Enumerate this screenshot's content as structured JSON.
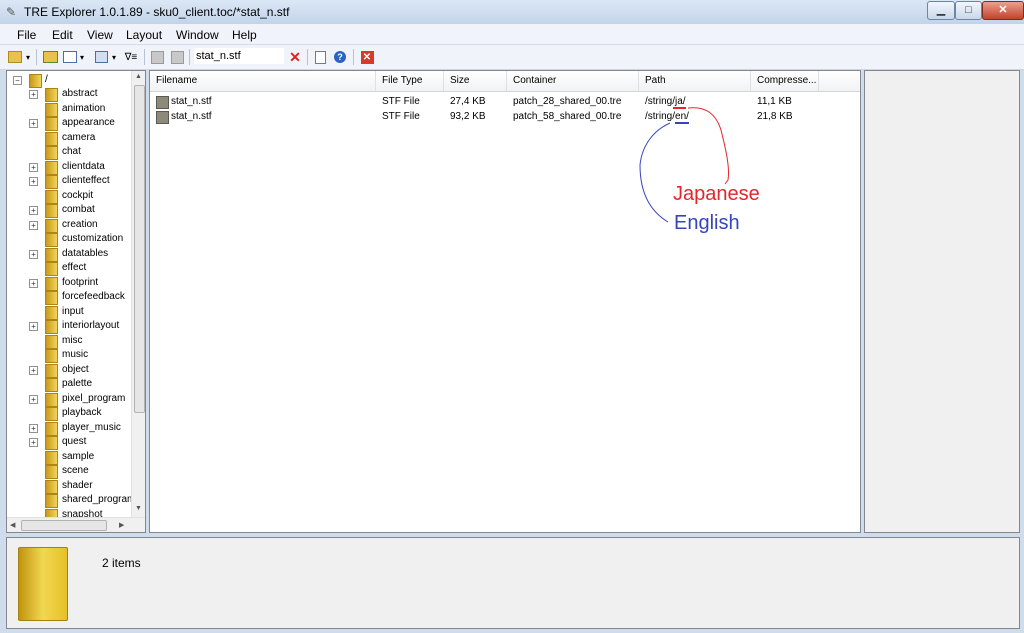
{
  "window": {
    "title": "TRE Explorer 1.0.1.89 - sku0_client.toc/*stat_n.stf",
    "minimize": "▁",
    "maximize": "□",
    "close": "✕"
  },
  "menu": [
    "File",
    "Edit",
    "View",
    "Layout",
    "Window",
    "Help"
  ],
  "toolbar": {
    "search_value": "stat_n.stf"
  },
  "tree": {
    "root": "/",
    "items": [
      {
        "label": "abstract",
        "expandable": true
      },
      {
        "label": "animation",
        "expandable": false
      },
      {
        "label": "appearance",
        "expandable": true
      },
      {
        "label": "camera",
        "expandable": false
      },
      {
        "label": "chat",
        "expandable": false
      },
      {
        "label": "clientdata",
        "expandable": true
      },
      {
        "label": "clienteffect",
        "expandable": true
      },
      {
        "label": "cockpit",
        "expandable": false
      },
      {
        "label": "combat",
        "expandable": true
      },
      {
        "label": "creation",
        "expandable": true
      },
      {
        "label": "customization",
        "expandable": false
      },
      {
        "label": "datatables",
        "expandable": true
      },
      {
        "label": "effect",
        "expandable": false
      },
      {
        "label": "footprint",
        "expandable": true
      },
      {
        "label": "forcefeedback",
        "expandable": false
      },
      {
        "label": "input",
        "expandable": false
      },
      {
        "label": "interiorlayout",
        "expandable": true
      },
      {
        "label": "misc",
        "expandable": false
      },
      {
        "label": "music",
        "expandable": false
      },
      {
        "label": "object",
        "expandable": true
      },
      {
        "label": "palette",
        "expandable": false
      },
      {
        "label": "pixel_program",
        "expandable": true
      },
      {
        "label": "playback",
        "expandable": false
      },
      {
        "label": "player_music",
        "expandable": true
      },
      {
        "label": "quest",
        "expandable": true
      },
      {
        "label": "sample",
        "expandable": false
      },
      {
        "label": "scene",
        "expandable": false
      },
      {
        "label": "shader",
        "expandable": false
      },
      {
        "label": "shared_program",
        "expandable": false
      },
      {
        "label": "snapshot",
        "expandable": false
      }
    ]
  },
  "list": {
    "columns": [
      "Filename",
      "File Type",
      "Size",
      "Container",
      "Path",
      "Compresse..."
    ],
    "rows": [
      {
        "filename": "stat_n.stf",
        "type": "STF File",
        "size": "27,4 KB",
        "container": "patch_28_shared_00.tre",
        "path": "/string/ja/",
        "compressed": "11,1 KB"
      },
      {
        "filename": "stat_n.stf",
        "type": "STF File",
        "size": "93,2 KB",
        "container": "patch_58_shared_00.tre",
        "path": "/string/en/",
        "compressed": "21,8 KB"
      }
    ]
  },
  "status": {
    "item_count": "2 items"
  },
  "annotations": {
    "japanese": "Japanese",
    "english": "English"
  },
  "colors": {
    "annotation_red": "#e3262c",
    "annotation_blue": "#3545bd"
  }
}
